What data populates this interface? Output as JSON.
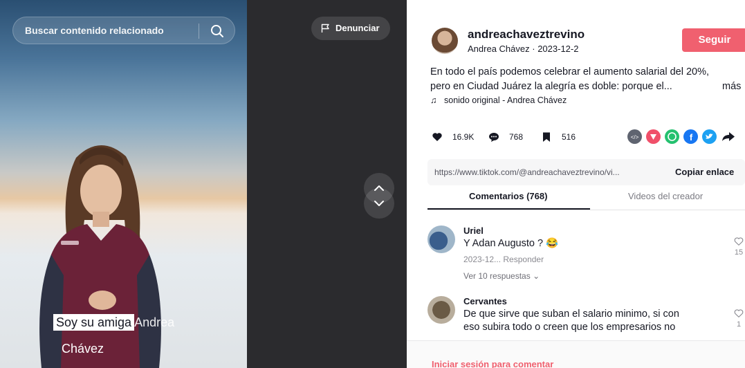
{
  "search": {
    "placeholder": "Buscar contenido relacionado",
    "icon": "search-icon"
  },
  "video": {
    "report_label": "Denunciar",
    "caption_highlight": "Soy su amiga",
    "caption_rest": "Andrea",
    "caption_line2": "Chávez",
    "nav_up_icon": "chevron-up-icon",
    "nav_down_icon": "chevron-down-icon"
  },
  "author": {
    "username": "andreachaveztrevino",
    "display_name": "Andrea Chávez",
    "date": "2023-12-2",
    "follow_label": "Seguir"
  },
  "post": {
    "description_line1": "En todo el país podemos celebrar el aumento salarial del 20%,",
    "description_line2": "pero en Ciudad Juárez la alegría es doble: porque el...",
    "more_label": "más",
    "sound": "sonido original - Andrea Chávez"
  },
  "stats": {
    "likes": "16.9K",
    "comments": "768",
    "saves": "516"
  },
  "share_icons": [
    "embed-icon",
    "send-icon",
    "whatsapp-icon",
    "facebook-icon",
    "twitter-icon",
    "share-arrow-icon"
  ],
  "link": {
    "url": "https://www.tiktok.com/@andreachaveztrevino/vi...",
    "copy_label": "Copiar enlace"
  },
  "tabs": [
    {
      "label": "Comentarios (768)",
      "active": true
    },
    {
      "label": "Videos del creador",
      "active": false
    }
  ],
  "comments": [
    {
      "name": "Uriel",
      "text": "Y Adan Augusto ? 😂",
      "date": "2023-12...",
      "reply_label": "Responder",
      "view_replies": "Ver 10 respuestas",
      "likes": "15"
    },
    {
      "name": "Cervantes",
      "text_line1": "De que sirve que suban el salario minimo, si con",
      "text_line2": "eso subira todo o creen que los empresarios no",
      "likes": "1"
    }
  ],
  "login_prompt": "Iniciar sesión para comentar",
  "colors": {
    "brand": "#f0606f",
    "video_bg": "#2b2b2e"
  }
}
